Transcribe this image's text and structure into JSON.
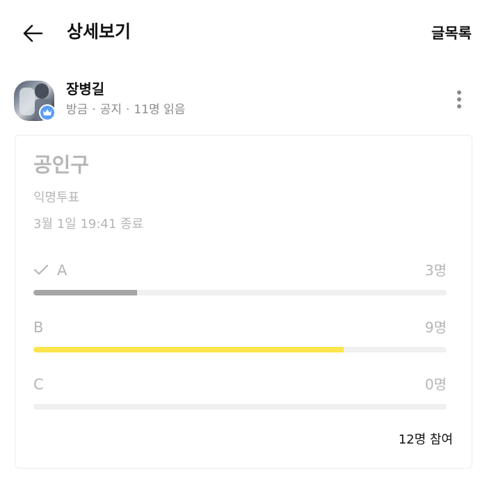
{
  "header": {
    "title": "상세보기",
    "list_link": "글목록"
  },
  "author": {
    "name": "장병길",
    "time": "방금",
    "category": "공지",
    "read_count": "11명 읽음",
    "separator": "·"
  },
  "poll": {
    "title": "공인구",
    "type": "익명투표",
    "deadline": "3월 1일 19:41 종료",
    "options": [
      {
        "label": "A",
        "count": "3명",
        "ratio": 0.25,
        "bar_color": "#a6a6a6",
        "checked": true
      },
      {
        "label": "B",
        "count": "9명",
        "ratio": 0.75,
        "bar_color": "#fce44d",
        "checked": false
      },
      {
        "label": "C",
        "count": "0명",
        "ratio": 0.0,
        "bar_color": "#a6a6a6",
        "checked": false
      }
    ],
    "participants": "12명 참여"
  },
  "colors": {
    "muted_text": "#b5b5b5",
    "meta_text": "#8a8a8a",
    "badge": "#5b9df5",
    "track": "#f0f0f0"
  }
}
